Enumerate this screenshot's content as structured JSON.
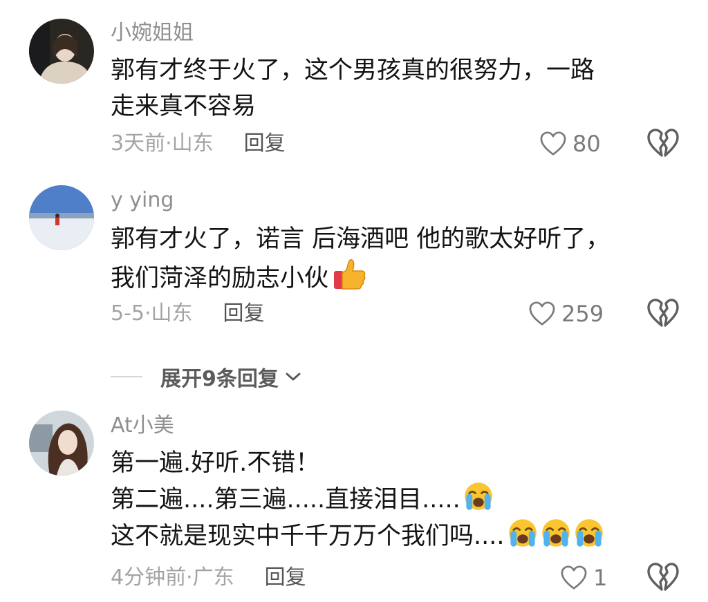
{
  "comments": [
    {
      "username": "小婉姐姐",
      "lines": [
        "郭有才终于火了，这个男孩真的很努力，一路",
        "走来真不容易"
      ],
      "meta": "3天前·山东",
      "reply_label": "回复",
      "likes": "80"
    },
    {
      "username": "y ying",
      "lines": [
        "郭有才火了，诺言 后海酒吧 他的歌太好听了，",
        "我们菏泽的励志小伙"
      ],
      "meta": "5-5·山东",
      "reply_label": "回复",
      "likes": "259"
    },
    {
      "username": "At小美",
      "lines": [
        "第一遍.好听.不错！",
        "第二遍....第三遍.....直接泪目.....",
        "这不就是现实中千千万万个我们吗...."
      ],
      "meta": "4分钟前·广东",
      "reply_label": "回复",
      "likes": "1"
    }
  ],
  "expand": {
    "label": "展开9条回复"
  },
  "icons": {
    "like": "heart-outline-icon",
    "dislike": "broken-heart-icon",
    "expand": "chevron-down-icon",
    "emoji_thumbs": "thumbs-up-emoji",
    "emoji_crying": "loudly-crying-emoji"
  },
  "colors": {
    "username": "#8f8f8f",
    "meta": "#a3a3a3",
    "reply": "#555555",
    "text": "#141414"
  }
}
